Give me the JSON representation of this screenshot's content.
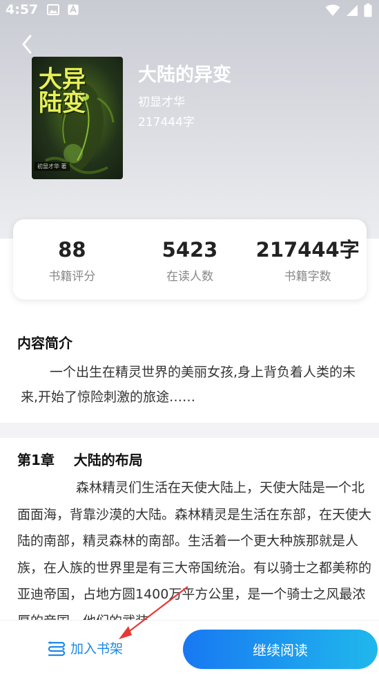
{
  "status_bar": {
    "time": "4:57",
    "icons_left": [
      "image-icon",
      "a-notification-icon"
    ],
    "icons_right": [
      "wifi-icon",
      "signal-icon",
      "battery-icon"
    ]
  },
  "book": {
    "title": "大陆的异变",
    "author": "初显才华",
    "word_count": "217444字",
    "cover": {
      "title_text": "大异陆变",
      "author_text": "初显才华 著"
    }
  },
  "stats": [
    {
      "value": "88",
      "label": "书籍评分"
    },
    {
      "value": "5423",
      "label": "在读人数"
    },
    {
      "value": "217444字",
      "label": "书籍字数"
    }
  ],
  "intro": {
    "heading": "内容简介",
    "text": "一个出生在精灵世界的美丽女孩,身上背负着人类的未来,开始了惊险刺激的旅途……"
  },
  "chapter": {
    "title": "第1章    大陆的布局",
    "text": "森林精灵们生活在天使大陆上，天使大陆是一个北面面海，背靠沙漠的大陆。森林精灵是生活在东部，在天使大陆的南部，精灵森林的南部。生活着一个更大种族那就是人族，在人族的世界里是有三大帝国统治。有以骑士之都美称的亚迪帝国，占地方圆1400万平方公里，是一个骑士之风最浓厚的帝国，他们的武装"
  },
  "bottom_bar": {
    "add_shelf_label": "加入书架",
    "continue_reading_label": "继续阅读"
  },
  "colors": {
    "accent": "#1a88e8",
    "button_gradient_start": "#1878f2",
    "button_gradient_end": "#20b8ec",
    "annotation_arrow": "#e53935"
  }
}
